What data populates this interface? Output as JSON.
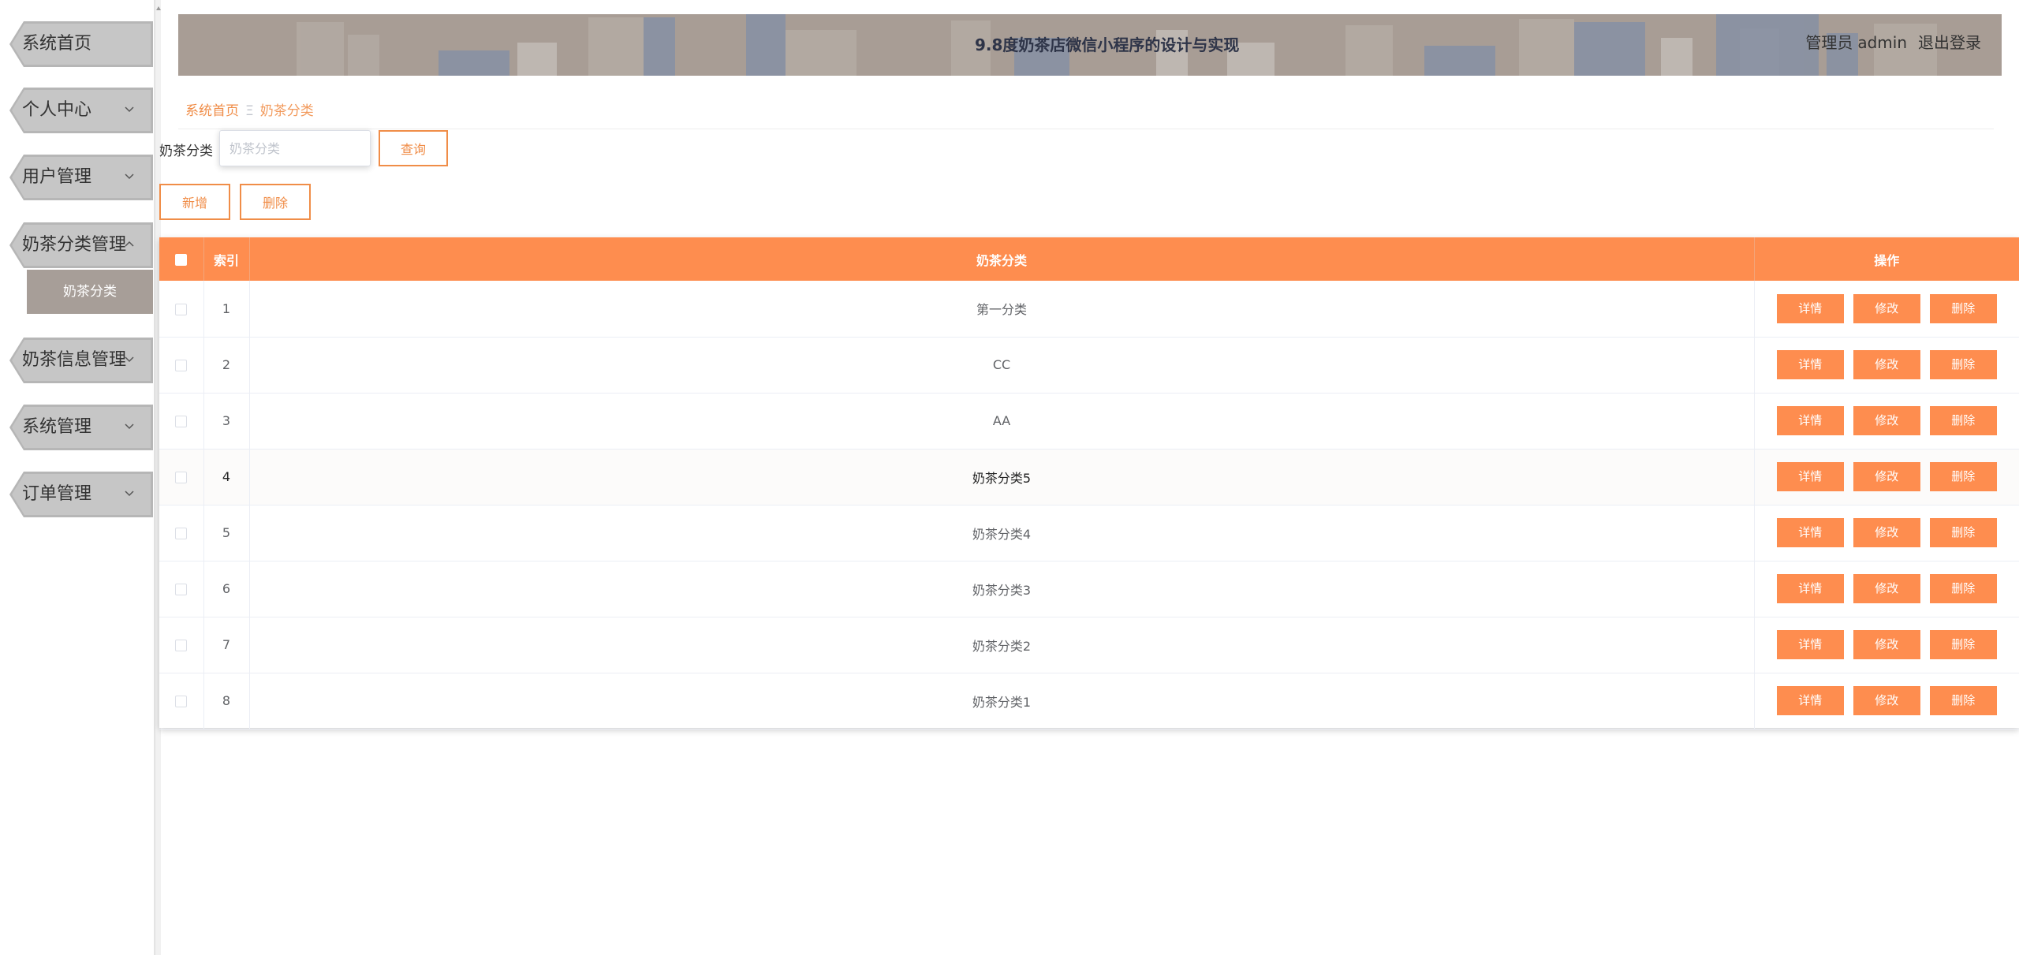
{
  "header": {
    "title": "9.8度奶茶店微信小程序的设计与实现",
    "role": "管理员",
    "username": "admin",
    "logout": "退出登录"
  },
  "sidebar": {
    "items": [
      {
        "label": "系统首页",
        "expandable": false
      },
      {
        "label": "个人中心",
        "expandable": true
      },
      {
        "label": "用户管理",
        "expandable": true
      },
      {
        "label": "奶茶分类管理",
        "expandable": true,
        "expanded": true
      },
      {
        "label": "奶茶信息管理",
        "expandable": true
      },
      {
        "label": "系统管理",
        "expandable": true
      },
      {
        "label": "订单管理",
        "expandable": true
      }
    ],
    "active_sub": "奶茶分类"
  },
  "breadcrumb": {
    "home": "系统首页",
    "separator": "Ξ",
    "current": "奶茶分类"
  },
  "search": {
    "label": "奶茶分类",
    "placeholder": "奶茶分类",
    "query_button": "查询"
  },
  "toolbar": {
    "add_label": "新增",
    "delete_label": "删除"
  },
  "table": {
    "columns": [
      "索引",
      "奶茶分类",
      "操作"
    ],
    "actions": [
      "详情",
      "修改",
      "删除"
    ],
    "rows": [
      {
        "index": "1",
        "name": "第一分类"
      },
      {
        "index": "2",
        "name": "CC"
      },
      {
        "index": "3",
        "name": "AA"
      },
      {
        "index": "4",
        "name": "奶茶分类5"
      },
      {
        "index": "5",
        "name": "奶茶分类4"
      },
      {
        "index": "6",
        "name": "奶茶分类3"
      },
      {
        "index": "7",
        "name": "奶茶分类2"
      },
      {
        "index": "8",
        "name": "奶茶分类1"
      }
    ],
    "hover_row": 3
  },
  "colors": {
    "accent": "#fe8d4f",
    "accent_text": "#f08d48",
    "banner": "#a89d95",
    "nav": "#c6c6c6",
    "sub_active": "#a79e98"
  },
  "icons": {
    "chevron_down": "chevron-down-icon",
    "chevron_up": "chevron-up-icon"
  }
}
